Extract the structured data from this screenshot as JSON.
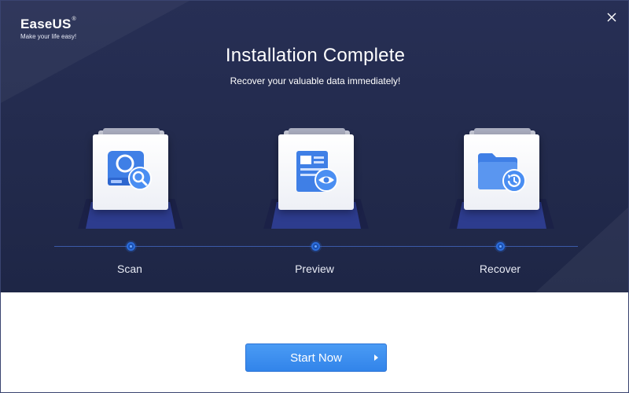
{
  "app": {
    "brand": "EaseUS",
    "brand_mark": "®",
    "tagline": "Make your life easy!"
  },
  "header": {
    "title": "Installation Complete",
    "subtitle": "Recover your valuable data immediately!"
  },
  "steps": [
    {
      "label": "Scan",
      "icon": "disk-search-icon"
    },
    {
      "label": "Preview",
      "icon": "document-preview-icon"
    },
    {
      "label": "Recover",
      "icon": "folder-restore-icon"
    }
  ],
  "actions": {
    "start_label": "Start Now",
    "close_icon": "close-icon"
  },
  "colors": {
    "hero_background": "#242c50",
    "accent_blue": "#3a8cf0",
    "icon_blue": "#3f7fe6",
    "platform_blue": "#2d3c8e"
  }
}
